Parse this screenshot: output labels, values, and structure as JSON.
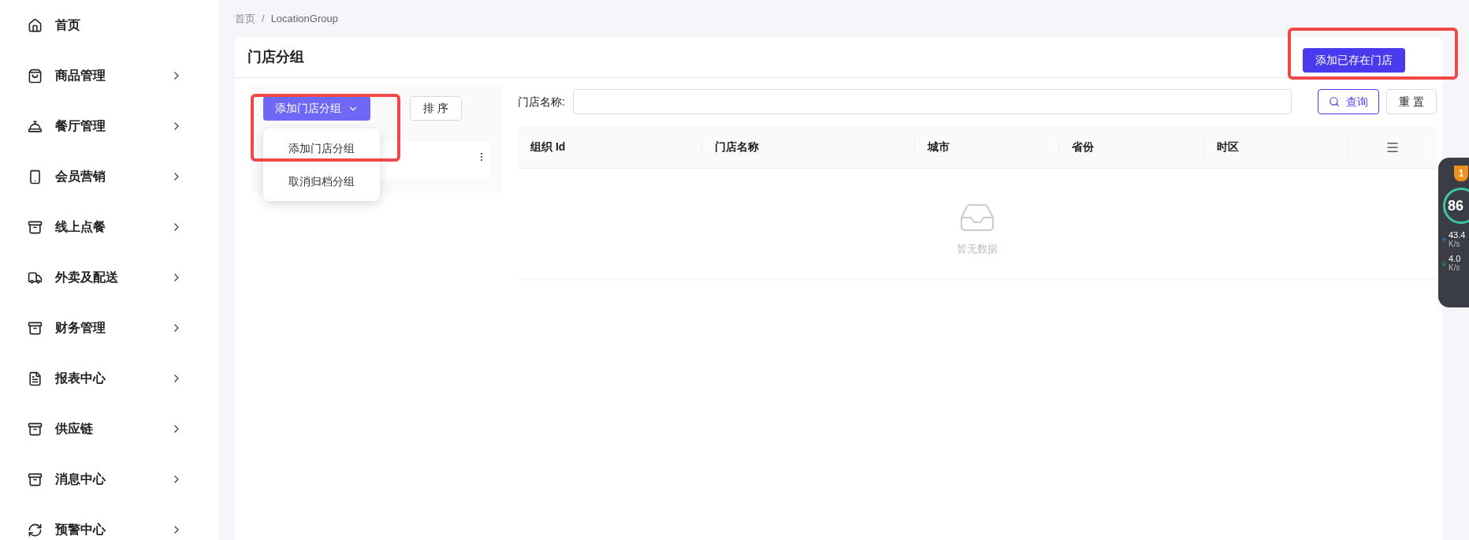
{
  "sidebar": {
    "items": [
      {
        "label": "首页",
        "expandable": false
      },
      {
        "label": "商品管理",
        "expandable": true
      },
      {
        "label": "餐厅管理",
        "expandable": true
      },
      {
        "label": "会员营销",
        "expandable": true
      },
      {
        "label": "线上点餐",
        "expandable": true
      },
      {
        "label": "外卖及配送",
        "expandable": true
      },
      {
        "label": "财务管理",
        "expandable": true
      },
      {
        "label": "报表中心",
        "expandable": true
      },
      {
        "label": "供应链",
        "expandable": true
      },
      {
        "label": "消息中心",
        "expandable": true
      },
      {
        "label": "预警中心",
        "expandable": true
      }
    ]
  },
  "breadcrumb": [
    "首页",
    "LocationGroup"
  ],
  "breadcrumb_separator": "/",
  "page": {
    "title": "门店分组",
    "header_button": "添加已存在门店"
  },
  "group_panel": {
    "add_button": "添加门店分组",
    "sort_button": "排 序",
    "dropdown": [
      "添加门店分组",
      "取消归档分组"
    ]
  },
  "search": {
    "label": "门店名称:",
    "query_button": "查询",
    "reset_button": "重 置"
  },
  "table": {
    "columns": [
      "组织 Id",
      "门店名称",
      "城市",
      "省份",
      "时区"
    ],
    "empty_text": "暂无数据"
  },
  "widget": {
    "badge": "1",
    "percent": "86",
    "upload": "43.4",
    "upload_unit": "K/s",
    "download": "4.0",
    "download_unit": "K/s"
  }
}
